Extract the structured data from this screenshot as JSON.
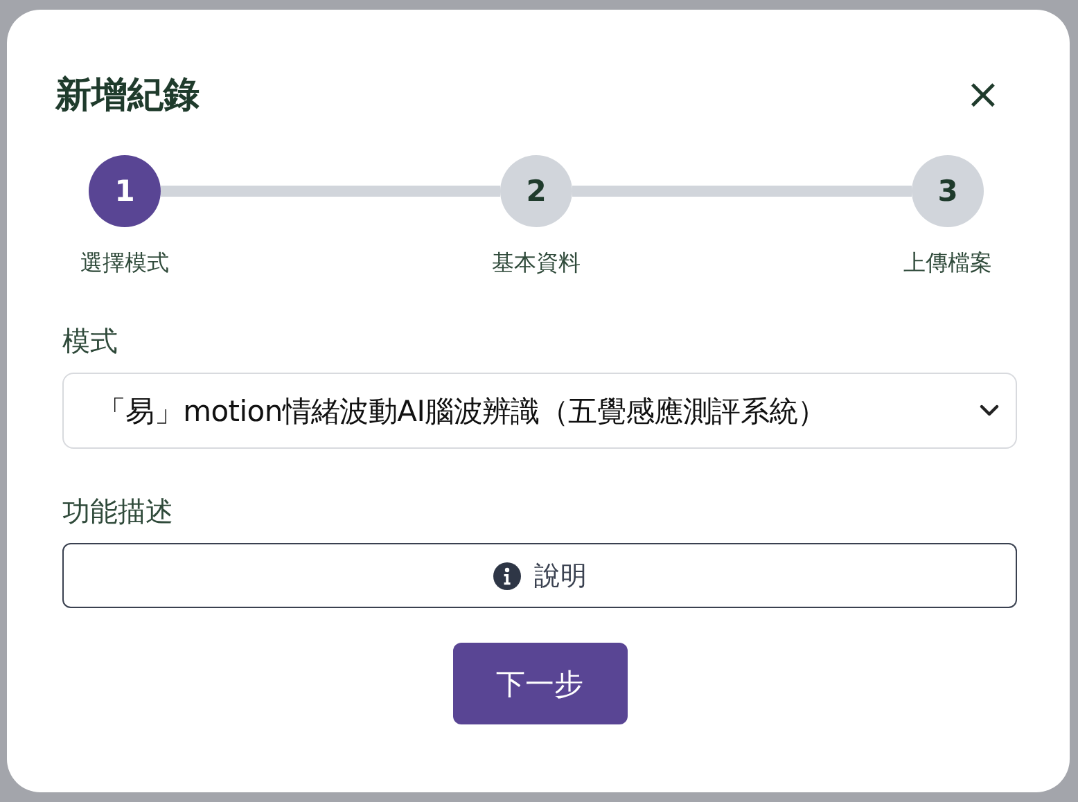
{
  "dialog": {
    "title": "新增紀錄",
    "close": "×"
  },
  "steps": [
    {
      "number": "1",
      "label": "選擇模式",
      "selected": true
    },
    {
      "number": "2",
      "label": "基本資料",
      "selected": false
    },
    {
      "number": "3",
      "label": "上傳檔案",
      "selected": false
    }
  ],
  "mode": {
    "label": "模式",
    "value": "「易」motion情緒波動AI腦波辨識（五覺感應測評系統）"
  },
  "description": {
    "label": "功能描述",
    "button": "說明"
  },
  "next_button": "下一步"
}
